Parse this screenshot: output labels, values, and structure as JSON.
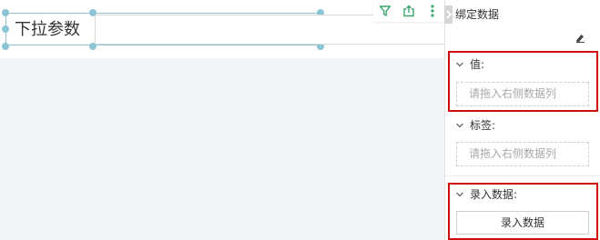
{
  "widget": {
    "param_label": "下拉参数",
    "toolbar": {
      "icons": [
        "filter-icon",
        "export-icon",
        "more-vertical-icon"
      ]
    }
  },
  "panel": {
    "title": "绑定数据",
    "sections": {
      "value": {
        "label": "值:",
        "placeholder": "请拖入右侧数据列"
      },
      "tag": {
        "label": "标签:",
        "placeholder": "请拖入右侧数据列"
      },
      "entry": {
        "label": "录入数据:",
        "button_label": "录入数据"
      }
    }
  },
  "colors": {
    "selection": "#8cc6d6",
    "highlight": "#d20b0b",
    "toolbar_icon": "#3aa56b"
  }
}
